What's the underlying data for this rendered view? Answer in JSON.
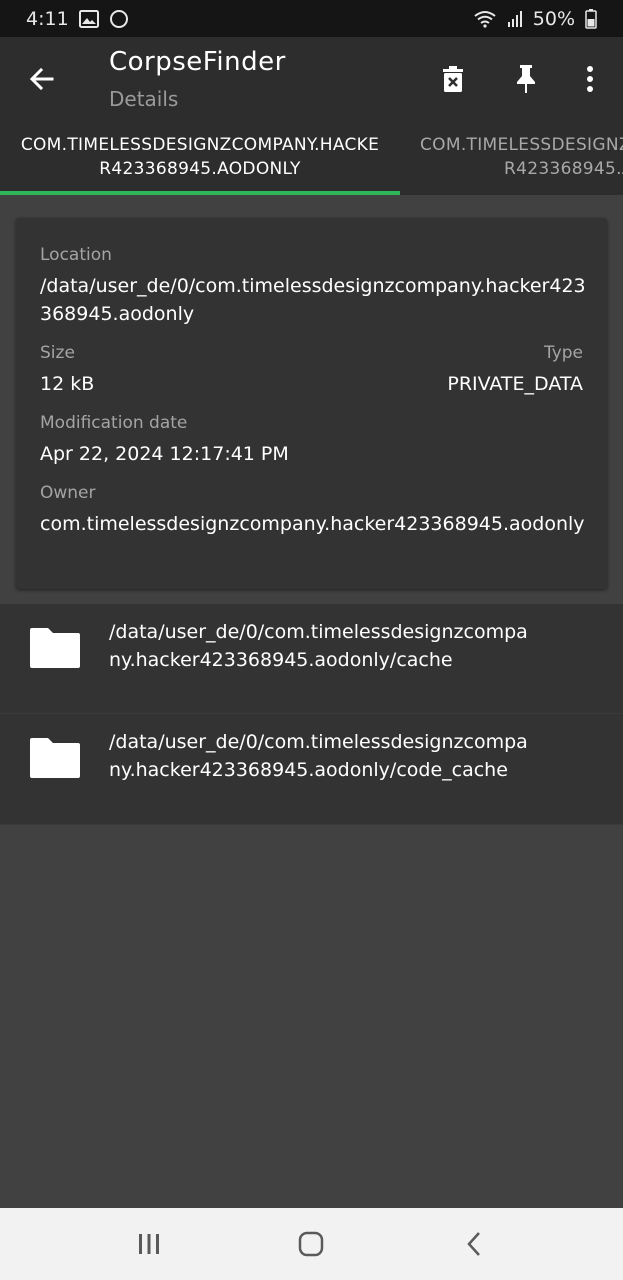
{
  "status_bar": {
    "time": "4:11",
    "battery": "50%",
    "icons": [
      "image-icon",
      "circle-icon",
      "wifi-icon",
      "signal-icon",
      "battery-icon"
    ]
  },
  "app_bar": {
    "title": "CorpseFinder",
    "subtitle": "Details",
    "icons": [
      "back-arrow-icon",
      "delete-icon",
      "pin-icon",
      "more-vert-icon"
    ]
  },
  "tabs": {
    "active": "COM.TIMELESSDESIGNZCOMPANY.HACKE\nR423368945.AODONLY",
    "inactive_line1": "COM.TIMELESSDESIGNZ",
    "inactive_line2": "R423368945.A"
  },
  "details": {
    "location_label": "Location",
    "location_value": "/data/user_de/0/com.timelessdesignzcompany.hacker423368945.aodonly",
    "size_label": "Size",
    "size_value": "12 kB",
    "type_label": "Type",
    "type_value": "PRIVATE_DATA",
    "modification_label": "Modification date",
    "modification_value": "Apr 22, 2024 12:17:41 PM",
    "owner_label": "Owner",
    "owner_value": "com.timelessdesignzcompany.hacker423368945.aodonly"
  },
  "files": [
    {
      "path": "/data/user_de/0/com.timelessdesignzcompany.hacker423368945.aodonly/cache"
    },
    {
      "path": "/data/user_de/0/com.timelessdesignzcompany.hacker423368945.aodonly/code_cache"
    }
  ],
  "nav_bar": {
    "icons": [
      "recents-icon",
      "home-icon",
      "nav-back-icon"
    ]
  },
  "colors": {
    "accent": "#2fb55a",
    "background": "#414141",
    "surface": "#333333",
    "app_bar": "#2d2d2d"
  }
}
